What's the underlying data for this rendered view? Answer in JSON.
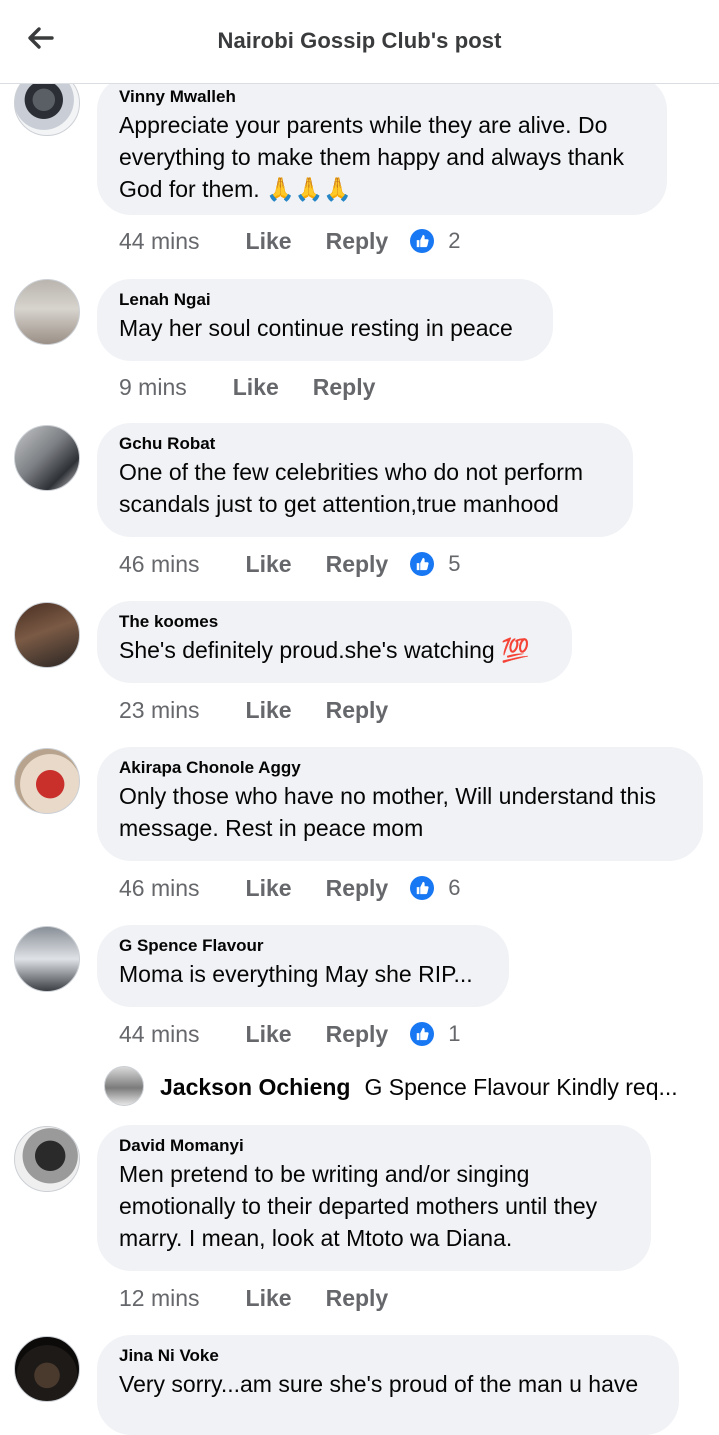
{
  "header": {
    "title": "Nairobi Gossip Club's post",
    "back_icon": "arrow-left-icon"
  },
  "colors": {
    "bubble": "#f0f2f5",
    "meta_text": "#65676b",
    "reaction_blue": "#1877f2"
  },
  "comments": [
    {
      "author": "Vinny Mwalleh",
      "lines": [
        "Appreciate your parents while they are alive. Do",
        "everything to make them happy and always thank",
        "God for them. 🙏🙏🙏"
      ],
      "time": "44 mins",
      "like": "Like",
      "reply": "Reply",
      "reactions": "2"
    },
    {
      "author": "Lenah Ngai",
      "lines": [
        "May her soul continue resting in peace"
      ],
      "time": "9 mins",
      "like": "Like",
      "reply": "Reply",
      "reactions": ""
    },
    {
      "author": "Gchu Robat",
      "lines": [
        "One of the few celebrities who do not perform",
        "scandals just to get attention,true manhood"
      ],
      "time": "46 mins",
      "like": "Like",
      "reply": "Reply",
      "reactions": "5"
    },
    {
      "author": "The koomes",
      "lines": [
        "She's definitely proud.she's watching 💯"
      ],
      "time": "23 mins",
      "like": "Like",
      "reply": "Reply",
      "reactions": ""
    },
    {
      "author": "Akirapa Chonole Aggy",
      "lines": [
        "Only those who have no mother, Will understand this",
        "message. Rest in peace mom"
      ],
      "time": "46 mins",
      "like": "Like",
      "reply": "Reply",
      "reactions": "6"
    },
    {
      "author": "G Spence Flavour",
      "lines": [
        "Moma is everything May she RIP..."
      ],
      "time": "44 mins",
      "like": "Like",
      "reply": "Reply",
      "reactions": "1"
    },
    {
      "author": "David Momanyi",
      "lines": [
        "Men pretend to be writing and/or singing",
        "emotionally to their departed mothers until they",
        "marry. I mean, look at Mtoto wa Diana."
      ],
      "time": "12 mins",
      "like": "Like",
      "reply": "Reply",
      "reactions": ""
    },
    {
      "author": "Jina Ni Voke",
      "lines": [
        "Very sorry...am sure she's proud of the man u have"
      ],
      "time": "",
      "like": "",
      "reply": "",
      "reactions": ""
    }
  ],
  "nested_reply": {
    "author": "Jackson Ochieng",
    "text": "G Spence Flavour Kindly req..."
  }
}
